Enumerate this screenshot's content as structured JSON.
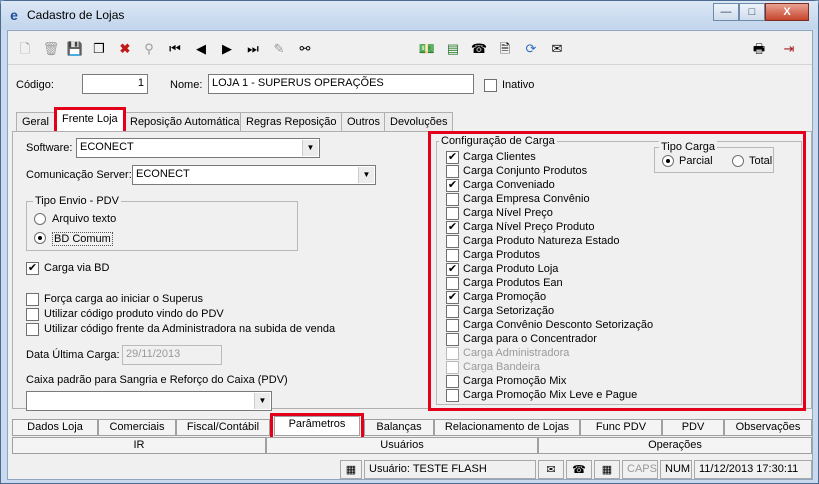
{
  "window": {
    "title": "Cadastro de Lojas",
    "minimize": "—",
    "maximize": "□",
    "close": "X"
  },
  "form": {
    "codigo_label": "Código:",
    "codigo_value": "1",
    "nome_label": "Nome:",
    "nome_value": "LOJA 1 - SUPERUS OPERAÇÕES",
    "inativo_label": "Inativo"
  },
  "tabs": [
    "Geral",
    "Frente Loja",
    "Reposição Automática",
    "Regras Reposição",
    "Outros",
    "Devoluções"
  ],
  "frente": {
    "software_label": "Software:",
    "software_value": "ECONECT",
    "comm_label": "Comunicação Server:",
    "comm_value": "ECONECT",
    "tipo_envio_label": "Tipo Envio -  PDV",
    "arquivo_label": "Arquivo texto",
    "bd_label": "BD Comum",
    "carga_bd_label": "Carga via BD",
    "forca_label": "Força carga ao iniciar o Superus",
    "utilizar_pdv_label": "Utilizar código produto vindo do PDV",
    "utilizar_adm_label": "Utilizar código frente da Administradora na subida de venda",
    "data_label": "Data Última Carga:",
    "data_value": "29/11/2013",
    "caixa_label": "Caixa padrão para Sangria e Reforço do Caixa (PDV)",
    "caixa_value": ""
  },
  "config": {
    "title": "Configuração de Carga",
    "tipo_carga_title": "Tipo Carga",
    "parcial": "Parcial",
    "total": "Total",
    "items": [
      {
        "label": "Carga Clientes",
        "mark": "✔"
      },
      {
        "label": "Carga Conjunto Produtos",
        "mark": ""
      },
      {
        "label": "Carga Conveniado",
        "mark": "✔"
      },
      {
        "label": "Carga Empresa Convênio",
        "mark": ""
      },
      {
        "label": "Carga Nível Preço",
        "mark": ""
      },
      {
        "label": "Carga Nível Preço Produto",
        "mark": "✔"
      },
      {
        "label": "Carga Produto Natureza Estado",
        "mark": ""
      },
      {
        "label": "Carga Produtos",
        "mark": ""
      },
      {
        "label": "Carga Produto Loja",
        "mark": "✔"
      },
      {
        "label": "Carga Produtos Ean",
        "mark": ""
      },
      {
        "label": "Carga Promoção",
        "mark": "✔"
      },
      {
        "label": "Carga Setorização",
        "mark": ""
      },
      {
        "label": "Carga Convênio Desconto Setorização",
        "mark": ""
      },
      {
        "label": "Carga para o Concentrador",
        "mark": ""
      },
      {
        "label": "Carga Administradora",
        "mark": ""
      },
      {
        "label": "Carga Bandeira",
        "mark": ""
      },
      {
        "label": "Carga Promoção Mix",
        "mark": ""
      },
      {
        "label": "Carga Promoção Mix Leve e Pague",
        "mark": ""
      }
    ]
  },
  "bottom_tabs_row1": [
    "Dados Loja",
    "Comerciais",
    "Fiscal/Contábil",
    "Parâmetros",
    "Balanças",
    "Relacionamento de Lojas",
    "Func PDV",
    "PDV",
    "Observações"
  ],
  "bottom_tabs_row2": [
    "IR",
    "Usuários",
    "Operações"
  ],
  "status": {
    "user": "Usuário: TESTE FLASH",
    "caps": "CAPS",
    "num": "NUM",
    "datetime": "11/12/2013 17:30:11"
  }
}
